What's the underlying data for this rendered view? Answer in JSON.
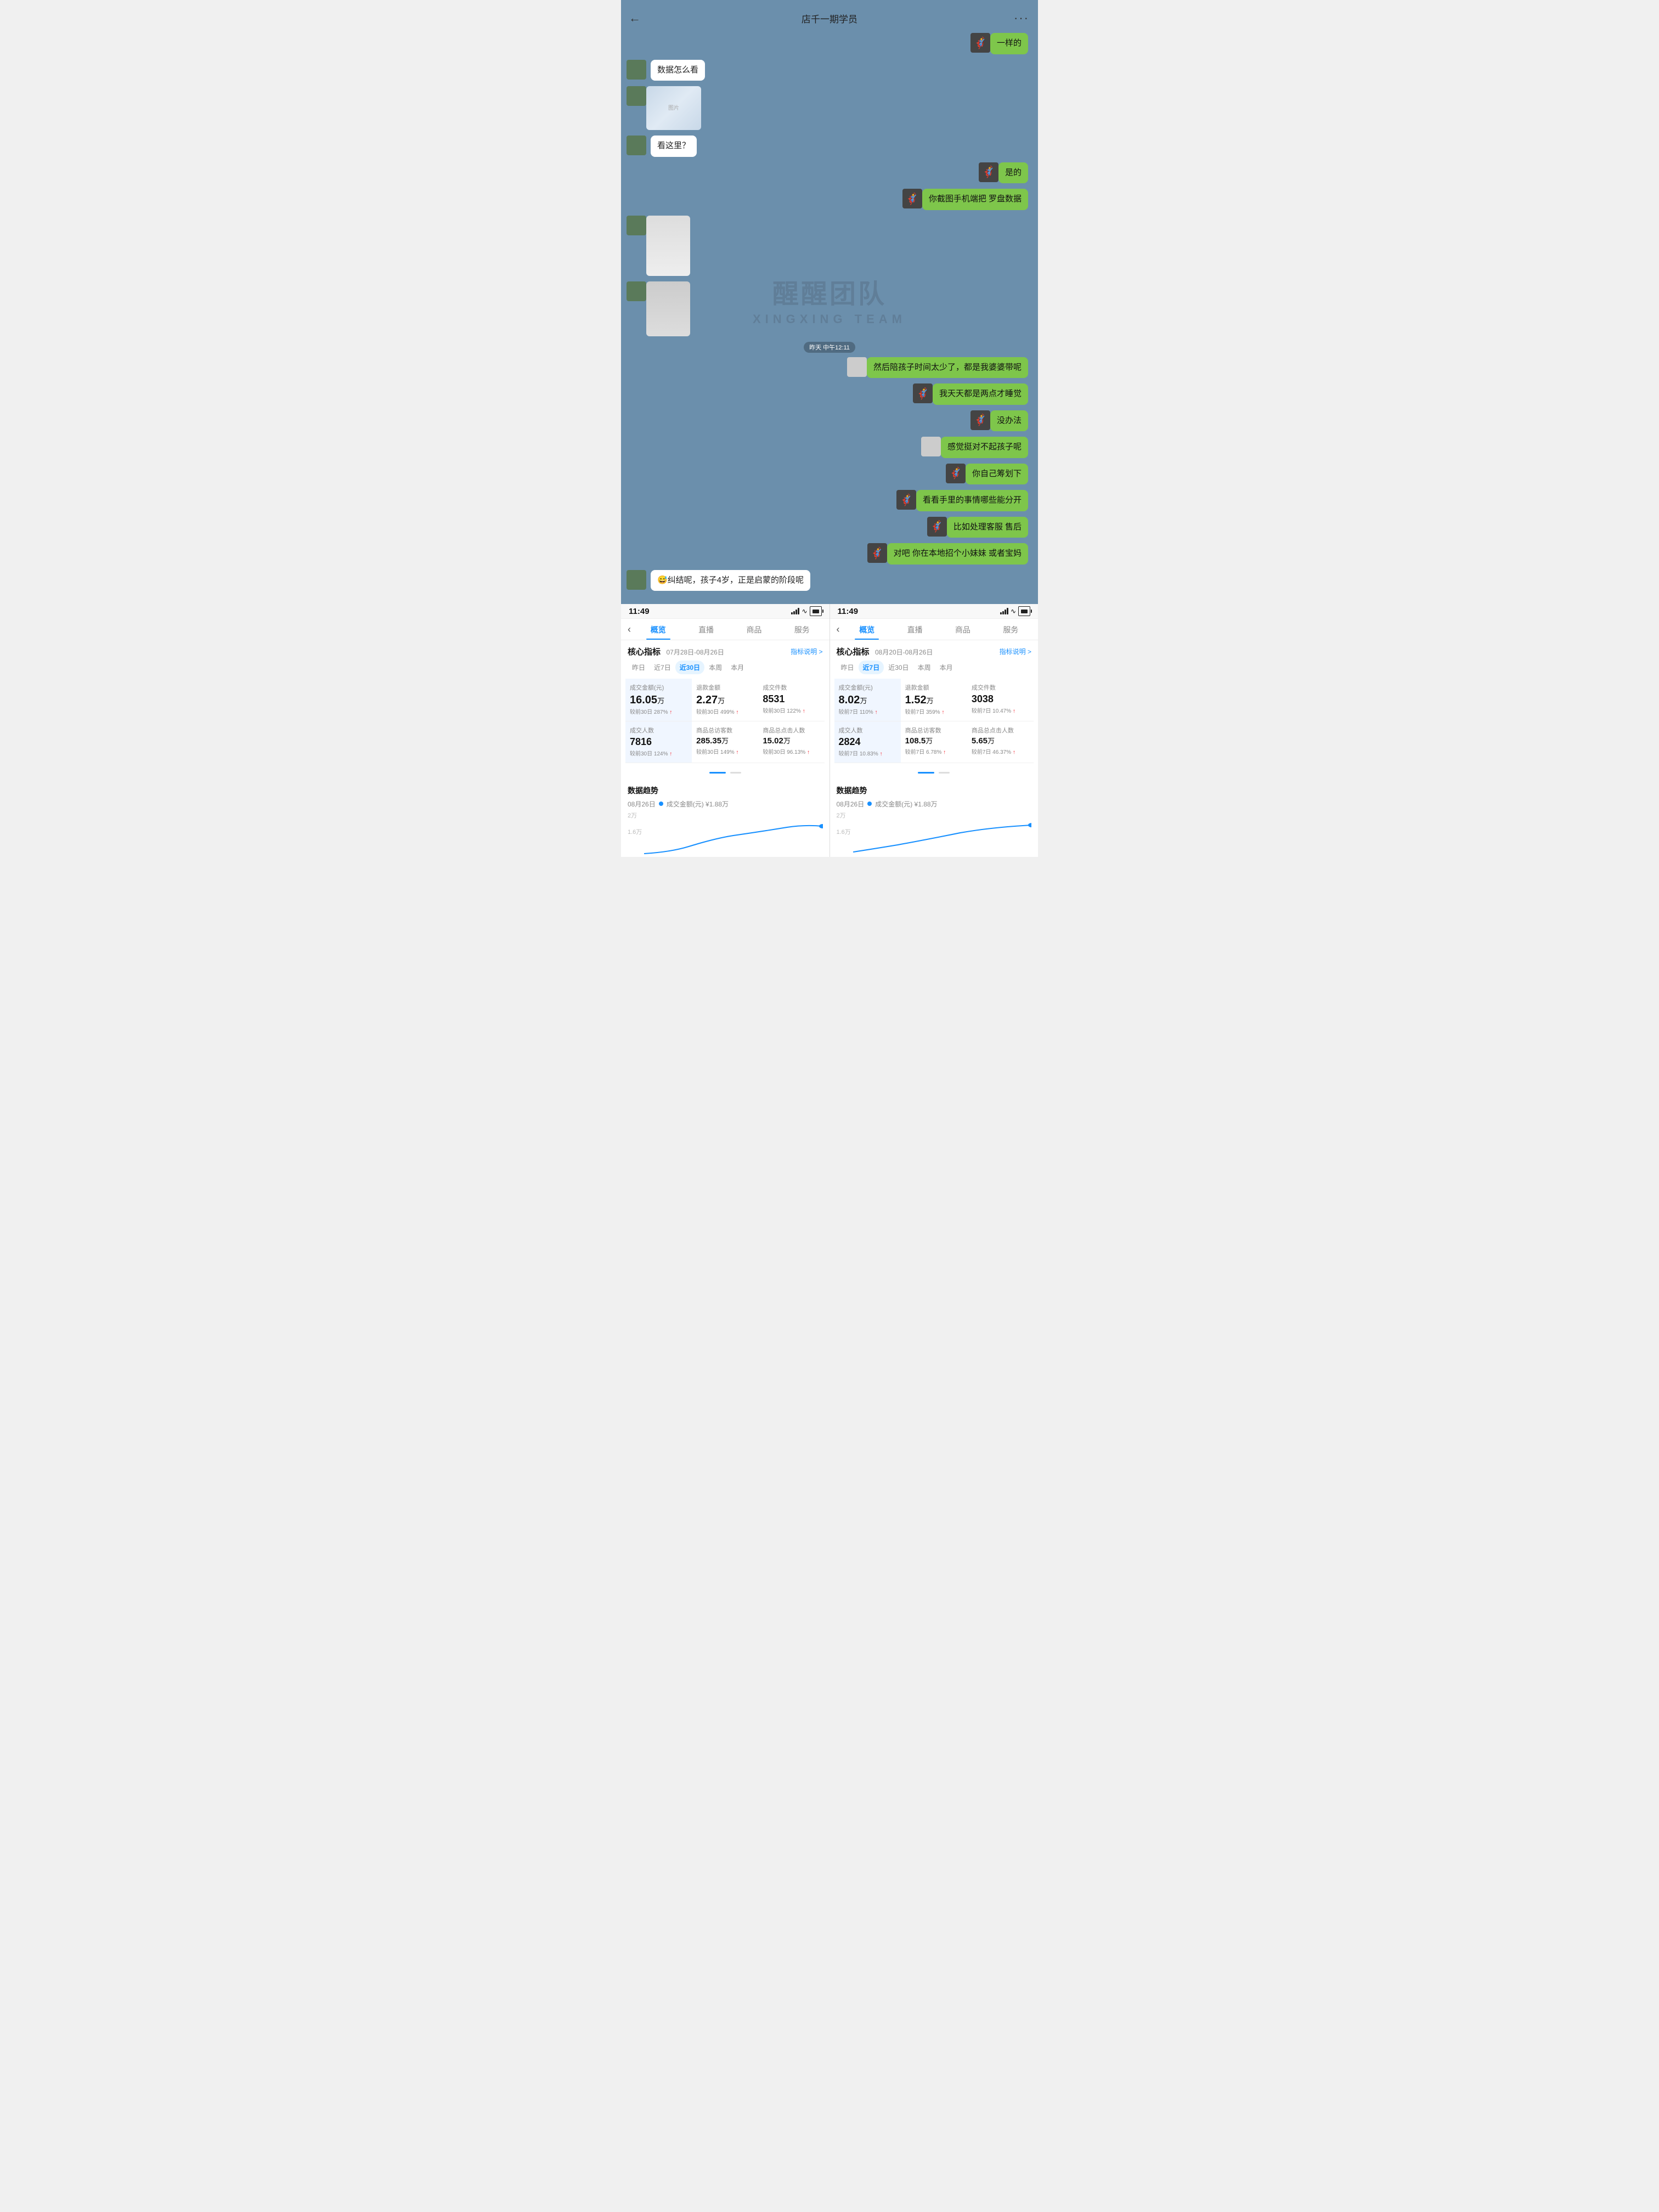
{
  "chat": {
    "header": {
      "back_icon": "←",
      "title": "店千一期学员",
      "more_icon": "···"
    },
    "messages": [
      {
        "id": 1,
        "side": "right",
        "type": "text",
        "text": "一样的",
        "avatar": "cat"
      },
      {
        "id": 2,
        "side": "left",
        "type": "text",
        "text": "数据怎么看",
        "avatar": "user"
      },
      {
        "id": 3,
        "side": "left",
        "type": "image",
        "avatar": "user"
      },
      {
        "id": 4,
        "side": "left",
        "type": "text",
        "text": "看这里？",
        "avatar": "user"
      },
      {
        "id": 5,
        "side": "right",
        "type": "text",
        "text": "是的",
        "avatar": "cat"
      },
      {
        "id": 6,
        "side": "right",
        "type": "text",
        "text": "你截图手机端把 罗盘数据",
        "avatar": "cat"
      },
      {
        "id": 7,
        "side": "left",
        "type": "image",
        "avatar": "user"
      },
      {
        "id": 8,
        "side": "left",
        "type": "image",
        "avatar": "user"
      },
      {
        "id": 9,
        "side": "right",
        "type": "text",
        "text": "然后陪孩子时间太少了，都是我婆婆带呢",
        "avatar": "none"
      },
      {
        "id": 10,
        "side": "right",
        "type": "text",
        "text": "我天天都是两点才睡觉",
        "avatar": "cat"
      },
      {
        "id": 11,
        "side": "right",
        "type": "text",
        "text": "没办法",
        "avatar": "cat"
      },
      {
        "id": 12,
        "side": "right",
        "type": "text",
        "text": "感觉挺对不起孩子呢",
        "avatar": "none"
      },
      {
        "id": 13,
        "side": "right",
        "type": "text",
        "text": "你自己筹划下",
        "avatar": "cat"
      },
      {
        "id": 14,
        "side": "right",
        "type": "text",
        "text": "看看手里的事情哪些能分开",
        "avatar": "cat"
      },
      {
        "id": 15,
        "side": "right",
        "type": "text",
        "text": "比如处理客服 售后",
        "avatar": "cat"
      },
      {
        "id": 16,
        "side": "right",
        "type": "text",
        "text": "对吧 你在本地招个小妹妹 或者宝妈",
        "avatar": "cat"
      },
      {
        "id": 17,
        "side": "left",
        "type": "text",
        "text": "😅纠结呢，孩子4岁，正是启蒙的阶段呢",
        "avatar": "user"
      }
    ],
    "timestamp": "昨天 中午12:11"
  },
  "screen_left": {
    "status_time": "11:49",
    "tabs": [
      "概览",
      "直播",
      "商品",
      "服务"
    ],
    "active_tab": "概览",
    "section_title": "核心指标",
    "date_range": "07月28日-08月26日",
    "explain_label": "指标说明 >",
    "period_tabs": [
      "昨日",
      "近7日",
      "近30日",
      "本周",
      "本月"
    ],
    "active_period": "近30日",
    "metrics": [
      {
        "label": "成交金额(元)",
        "value": "16.05万",
        "change": "较前30日 287%",
        "up": true
      },
      {
        "label": "退款金额",
        "value": "2.27万",
        "change": "较前30日 499%",
        "up": true
      },
      {
        "label": "成交件数",
        "value": "8531",
        "change": "较前30日 122%",
        "up": true
      },
      {
        "label": "成交人数",
        "value": "7816",
        "change": "较前30日 124%",
        "up": true
      },
      {
        "label": "商品总访客数",
        "value": "285.35万",
        "change": "较前30日 149%",
        "up": true
      },
      {
        "label": "商品总点击人数",
        "value": "15.02万",
        "change": "较前30日 96.13%",
        "up": true
      }
    ],
    "trend_title": "数据趋势",
    "trend_date": "08月26日",
    "trend_legend": "成交金额(元) ¥1.88万",
    "chart_labels": [
      "2万",
      "1.6万"
    ]
  },
  "screen_right": {
    "status_time": "11:49",
    "tabs": [
      "概览",
      "直播",
      "商品",
      "服务"
    ],
    "active_tab": "概览",
    "section_title": "核心指标",
    "date_range": "08月20日-08月26日",
    "explain_label": "指标说明 >",
    "period_tabs": [
      "昨日",
      "近7日",
      "近30日",
      "本周",
      "本月"
    ],
    "active_period": "近7日",
    "metrics": [
      {
        "label": "成交金额(元)",
        "value": "8.02万",
        "change": "较前7日 110%",
        "up": true
      },
      {
        "label": "退款金额",
        "value": "1.52万",
        "change": "较前7日 359%",
        "up": true
      },
      {
        "label": "成交件数",
        "value": "3038",
        "change": "较前7日 10.47%",
        "up": true
      },
      {
        "label": "成交人数",
        "value": "2824",
        "change": "较前7日 10.83%",
        "up": true
      },
      {
        "label": "商品总访客数",
        "value": "108.5万",
        "change": "较前7日 6.78%",
        "up": true
      },
      {
        "label": "商品总点击人数",
        "value": "5.65万",
        "change": "较前7日 46.37%",
        "up": true
      }
    ],
    "trend_title": "数据趋势",
    "trend_date": "08月26日",
    "trend_legend": "成交金额(元) ¥1.88万",
    "chart_labels": [
      "2万",
      "1.6万"
    ]
  },
  "watermark": {
    "line1": "醒醒团队",
    "line2": "XINGXING TEAM"
  }
}
